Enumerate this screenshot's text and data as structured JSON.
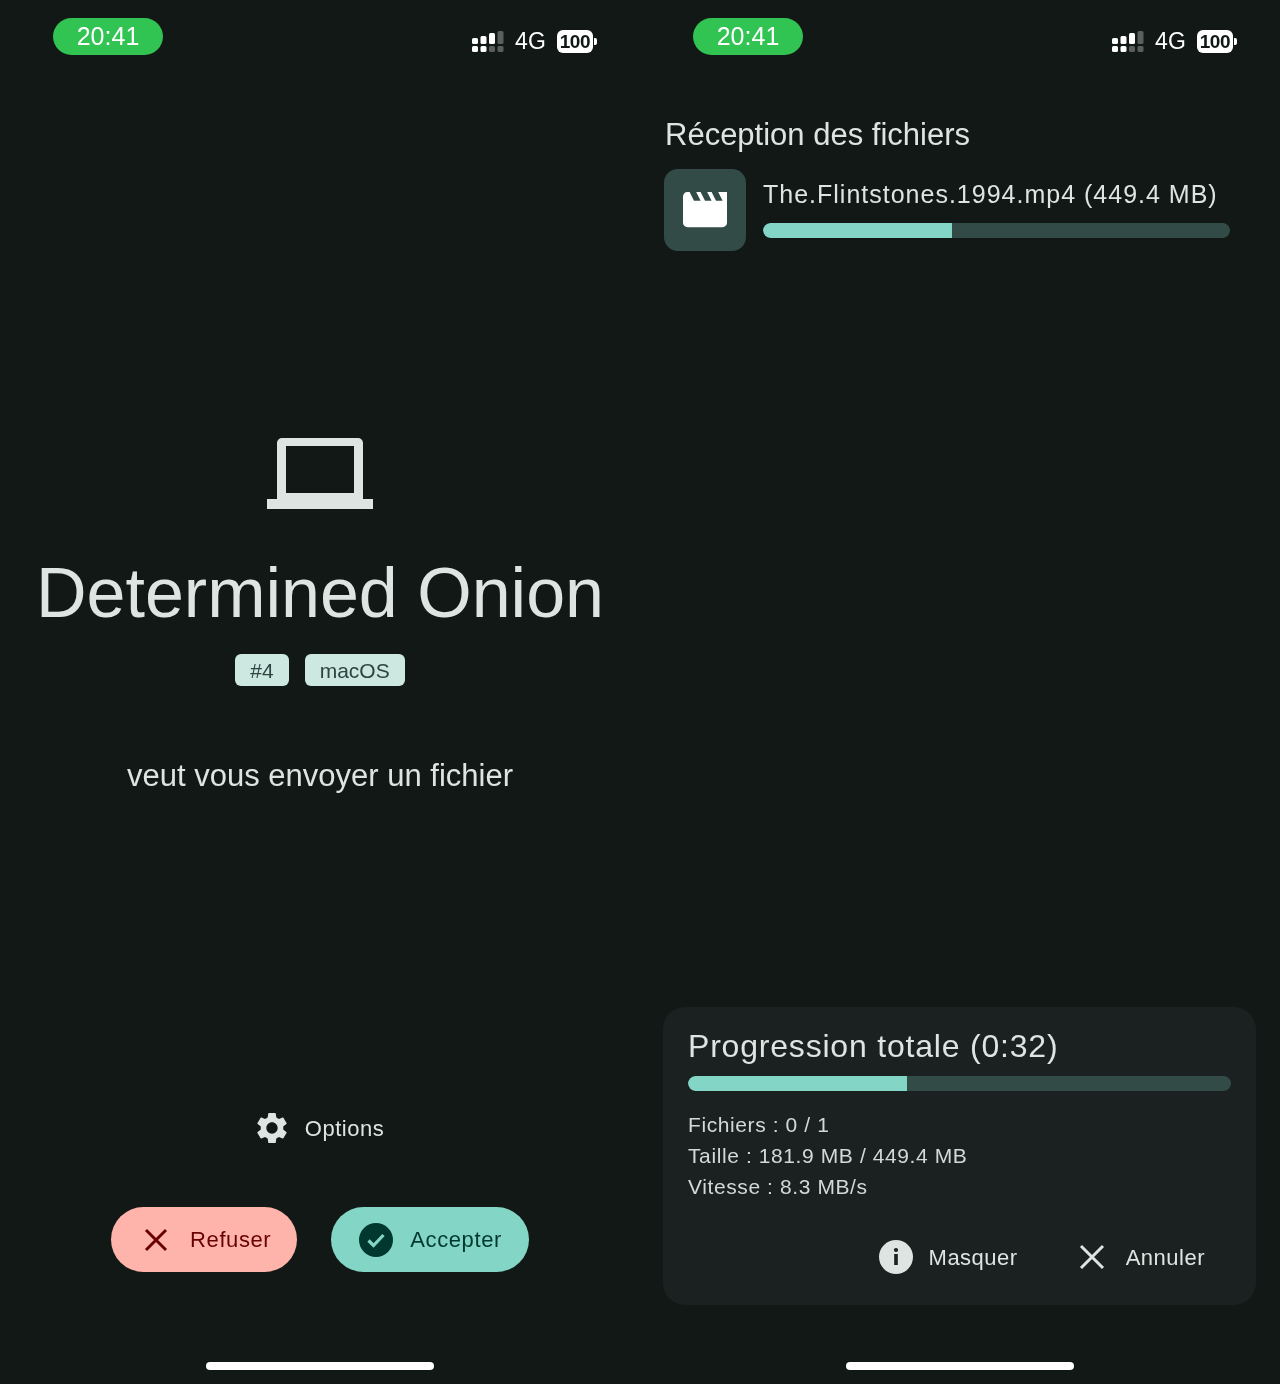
{
  "request_screen": {
    "status_bar": {
      "time": "20:41",
      "network": "4G",
      "battery": "100"
    },
    "device_name": "Determined Onion",
    "tags": [
      "#4",
      "macOS"
    ],
    "message": "veut vous envoyer un fichier",
    "options_button": {
      "label": "Options"
    },
    "actions": [
      {
        "kind": "decline",
        "label": "Refuser"
      },
      {
        "kind": "accept",
        "label": "Accepter"
      }
    ]
  },
  "transfer_screen": {
    "status_bar": {
      "time": "20:41",
      "network": "4G",
      "battery": "100"
    },
    "title": "Réception des fichiers",
    "files": [
      {
        "name": "The.Flintstones.1994.mp4 (449.4 MB)",
        "level": 0.405
      }
    ],
    "summary": {
      "title": "Progression totale (0:32)",
      "level": 0.403,
      "stats": [
        "Fichiers : 0 / 1",
        "Taille : 181.9 MB / 449.4 MB",
        "Vitesse : 8.3 MB/s"
      ],
      "actions": [
        {
          "kind": "hide",
          "label": "Masquer"
        },
        {
          "kind": "cancel",
          "label": "Annuler"
        }
      ]
    }
  }
}
